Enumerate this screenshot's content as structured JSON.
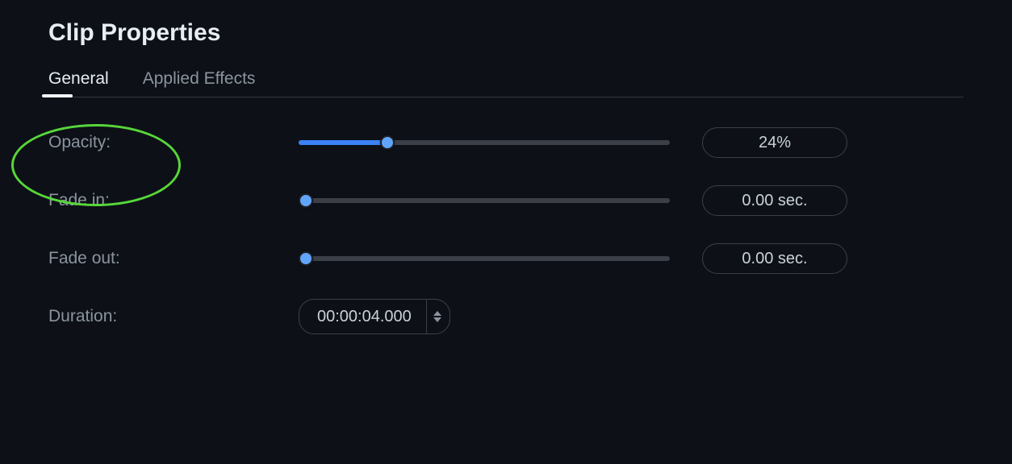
{
  "panel": {
    "title": "Clip Properties"
  },
  "tabs": {
    "general": "General",
    "applied_effects": "Applied Effects"
  },
  "rows": {
    "opacity": {
      "label": "Opacity:",
      "value": "24%",
      "slider_percent": 24
    },
    "fade_in": {
      "label": "Fade in:",
      "value": "0.00 sec.",
      "slider_percent": 0
    },
    "fade_out": {
      "label": "Fade out:",
      "value": "0.00 sec.",
      "slider_percent": 0
    },
    "duration": {
      "label": "Duration:",
      "value": "00:00:04.000"
    }
  }
}
